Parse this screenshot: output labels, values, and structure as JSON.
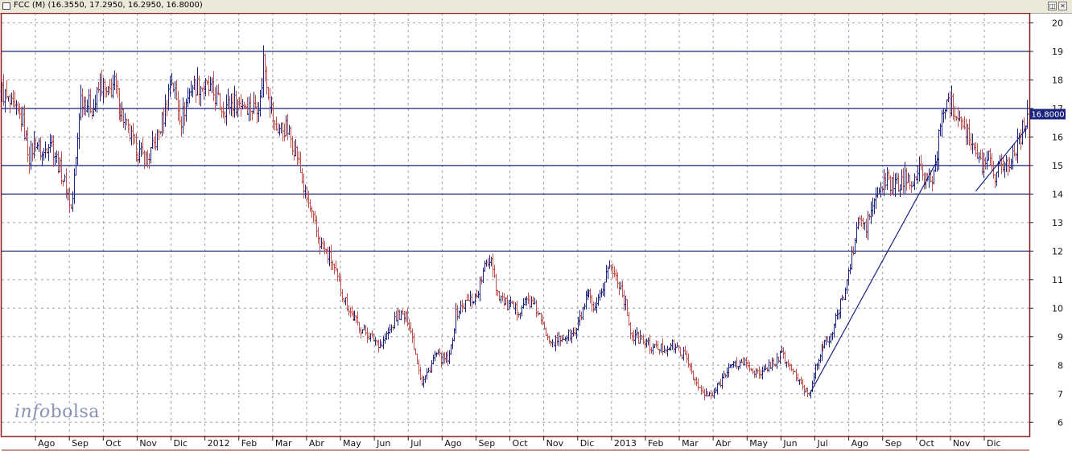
{
  "window": {
    "title": "FCC (M) (16.3550, 17.2950, 16.2950, 16.8000)",
    "buttons": [
      "◫",
      "✕"
    ]
  },
  "watermark": {
    "part1": "info",
    "part2": "bolsa"
  },
  "colors": {
    "up": "#1a237e",
    "down": "#c0504d",
    "line": "#1a237e",
    "grid": "#9aa0aa",
    "frame": "#8b1a1a",
    "label_bg": "#1a237e"
  },
  "chart_data": {
    "type": "bar",
    "subtype": "ohlc",
    "symbol": "FCC",
    "last_value_label": "16.8000",
    "last": {
      "open": 16.355,
      "high": 17.295,
      "low": 16.295,
      "close": 16.8
    },
    "y_ticks": [
      6,
      7,
      8,
      9,
      10,
      11,
      12,
      13,
      14,
      15,
      16,
      17,
      18,
      19,
      20
    ],
    "ylim": [
      5.5,
      20.35
    ],
    "x_labels": [
      "Ago",
      "Sep",
      "Oct",
      "Nov",
      "Dic",
      "2012",
      "Feb",
      "Mar",
      "Abr",
      "May",
      "Jun",
      "Jul",
      "Ago",
      "Sep",
      "Oct",
      "Nov",
      "Dic",
      "2013",
      "Feb",
      "Mar",
      "Abr",
      "May",
      "Jun",
      "Jul",
      "Ago",
      "Sep",
      "Oct",
      "Nov",
      "Dic"
    ],
    "x_tick_positions": [
      2.3,
      3.3,
      4.3,
      5.3,
      6.3,
      7.3,
      8.3,
      9.3,
      10.3,
      11.3,
      12.3,
      13.3,
      14.3,
      15.3,
      16.3,
      17.3,
      18.3,
      19.3,
      20.3,
      21.3,
      22.3,
      23.3,
      24.3,
      25.3,
      26.3,
      27.3,
      28.3,
      29.3,
      30.3
    ],
    "xlim": [
      1.3,
      31.63
    ],
    "horizontal_lines": [
      19,
      17,
      15,
      14,
      12
    ],
    "trendlines": [
      {
        "from": [
          25.15,
          7.0
        ],
        "to": [
          28.95,
          15.25
        ]
      },
      {
        "from": [
          30.05,
          14.1
        ],
        "to": [
          31.55,
          16.3
        ]
      }
    ],
    "price_path": [
      [
        1.3,
        17.6
      ],
      [
        1.6,
        17.0
      ],
      [
        1.9,
        16.6
      ],
      [
        2.1,
        15.3
      ],
      [
        2.3,
        15.9
      ],
      [
        2.5,
        15.3
      ],
      [
        2.7,
        16.0
      ],
      [
        3.0,
        14.9
      ],
      [
        3.2,
        14.2
      ],
      [
        3.35,
        13.4
      ],
      [
        3.5,
        15.5
      ],
      [
        3.6,
        17.4
      ],
      [
        3.8,
        17.2
      ],
      [
        4.0,
        17.0
      ],
      [
        4.2,
        17.9
      ],
      [
        4.4,
        17.4
      ],
      [
        4.6,
        17.9
      ],
      [
        4.8,
        17.0
      ],
      [
        5.0,
        16.3
      ],
      [
        5.3,
        15.5
      ],
      [
        5.6,
        15.2
      ],
      [
        5.9,
        16.0
      ],
      [
        6.1,
        16.8
      ],
      [
        6.3,
        18.1
      ],
      [
        6.6,
        16.6
      ],
      [
        6.9,
        17.8
      ],
      [
        7.2,
        17.8
      ],
      [
        7.5,
        17.6
      ],
      [
        7.8,
        17.0
      ],
      [
        8.1,
        17.2
      ],
      [
        8.4,
        17.2
      ],
      [
        8.7,
        17.0
      ],
      [
        8.95,
        17.3
      ],
      [
        9.0,
        18.9
      ],
      [
        9.15,
        17.7
      ],
      [
        9.35,
        16.3
      ],
      [
        9.7,
        16.3
      ],
      [
        10.0,
        15.4
      ],
      [
        10.2,
        14.2
      ],
      [
        10.5,
        13.0
      ],
      [
        10.7,
        12.2
      ],
      [
        11.0,
        11.7
      ],
      [
        11.3,
        10.6
      ],
      [
        11.6,
        9.8
      ],
      [
        11.9,
        9.3
      ],
      [
        12.2,
        9.0
      ],
      [
        12.5,
        8.7
      ],
      [
        12.8,
        9.3
      ],
      [
        13.0,
        9.8
      ],
      [
        13.3,
        9.6
      ],
      [
        13.5,
        8.5
      ],
      [
        13.7,
        7.4
      ],
      [
        13.9,
        7.8
      ],
      [
        14.1,
        8.4
      ],
      [
        14.3,
        8.2
      ],
      [
        14.5,
        8.2
      ],
      [
        14.7,
        9.8
      ],
      [
        15.0,
        10.2
      ],
      [
        15.3,
        10.4
      ],
      [
        15.6,
        11.6
      ],
      [
        15.75,
        11.8
      ],
      [
        15.9,
        10.6
      ],
      [
        16.2,
        10.1
      ],
      [
        16.5,
        9.9
      ],
      [
        16.8,
        10.3
      ],
      [
        17.1,
        9.9
      ],
      [
        17.3,
        9.2
      ],
      [
        17.6,
        8.8
      ],
      [
        17.9,
        9.0
      ],
      [
        18.2,
        9.1
      ],
      [
        18.4,
        9.8
      ],
      [
        18.6,
        10.5
      ],
      [
        18.8,
        9.8
      ],
      [
        19.0,
        10.5
      ],
      [
        19.2,
        11.5
      ],
      [
        19.5,
        11.0
      ],
      [
        19.7,
        10.2
      ],
      [
        19.9,
        9.0
      ],
      [
        20.2,
        8.9
      ],
      [
        20.5,
        8.6
      ],
      [
        20.8,
        8.6
      ],
      [
        21.1,
        8.7
      ],
      [
        21.4,
        8.4
      ],
      [
        21.6,
        8.0
      ],
      [
        21.8,
        7.3
      ],
      [
        22.0,
        7.0
      ],
      [
        22.25,
        6.9
      ],
      [
        22.5,
        7.4
      ],
      [
        22.7,
        7.9
      ],
      [
        22.9,
        8.0
      ],
      [
        23.2,
        8.1
      ],
      [
        23.5,
        7.8
      ],
      [
        23.7,
        7.6
      ],
      [
        23.9,
        8.0
      ],
      [
        24.1,
        8.1
      ],
      [
        24.3,
        8.4
      ],
      [
        24.5,
        8.0
      ],
      [
        24.7,
        7.7
      ],
      [
        24.9,
        7.2
      ],
      [
        25.15,
        7.0
      ],
      [
        25.3,
        8.0
      ],
      [
        25.5,
        8.6
      ],
      [
        25.8,
        9.1
      ],
      [
        26.0,
        9.9
      ],
      [
        26.2,
        10.7
      ],
      [
        26.4,
        11.8
      ],
      [
        26.6,
        13.2
      ],
      [
        26.8,
        12.8
      ],
      [
        27.0,
        13.6
      ],
      [
        27.2,
        14.1
      ],
      [
        27.4,
        14.5
      ],
      [
        27.6,
        14.3
      ],
      [
        27.8,
        14.3
      ],
      [
        28.0,
        14.6
      ],
      [
        28.2,
        14.5
      ],
      [
        28.4,
        14.8
      ],
      [
        28.6,
        14.5
      ],
      [
        28.8,
        14.6
      ],
      [
        29.0,
        16.4
      ],
      [
        29.15,
        17.3
      ],
      [
        29.35,
        17.1
      ],
      [
        29.55,
        16.8
      ],
      [
        29.8,
        16.2
      ],
      [
        30.0,
        15.4
      ],
      [
        30.2,
        15.0
      ],
      [
        30.4,
        15.4
      ],
      [
        30.6,
        14.7
      ],
      [
        30.8,
        15.2
      ],
      [
        31.0,
        15.0
      ],
      [
        31.2,
        15.6
      ],
      [
        31.4,
        16.2
      ],
      [
        31.55,
        16.8
      ]
    ]
  }
}
